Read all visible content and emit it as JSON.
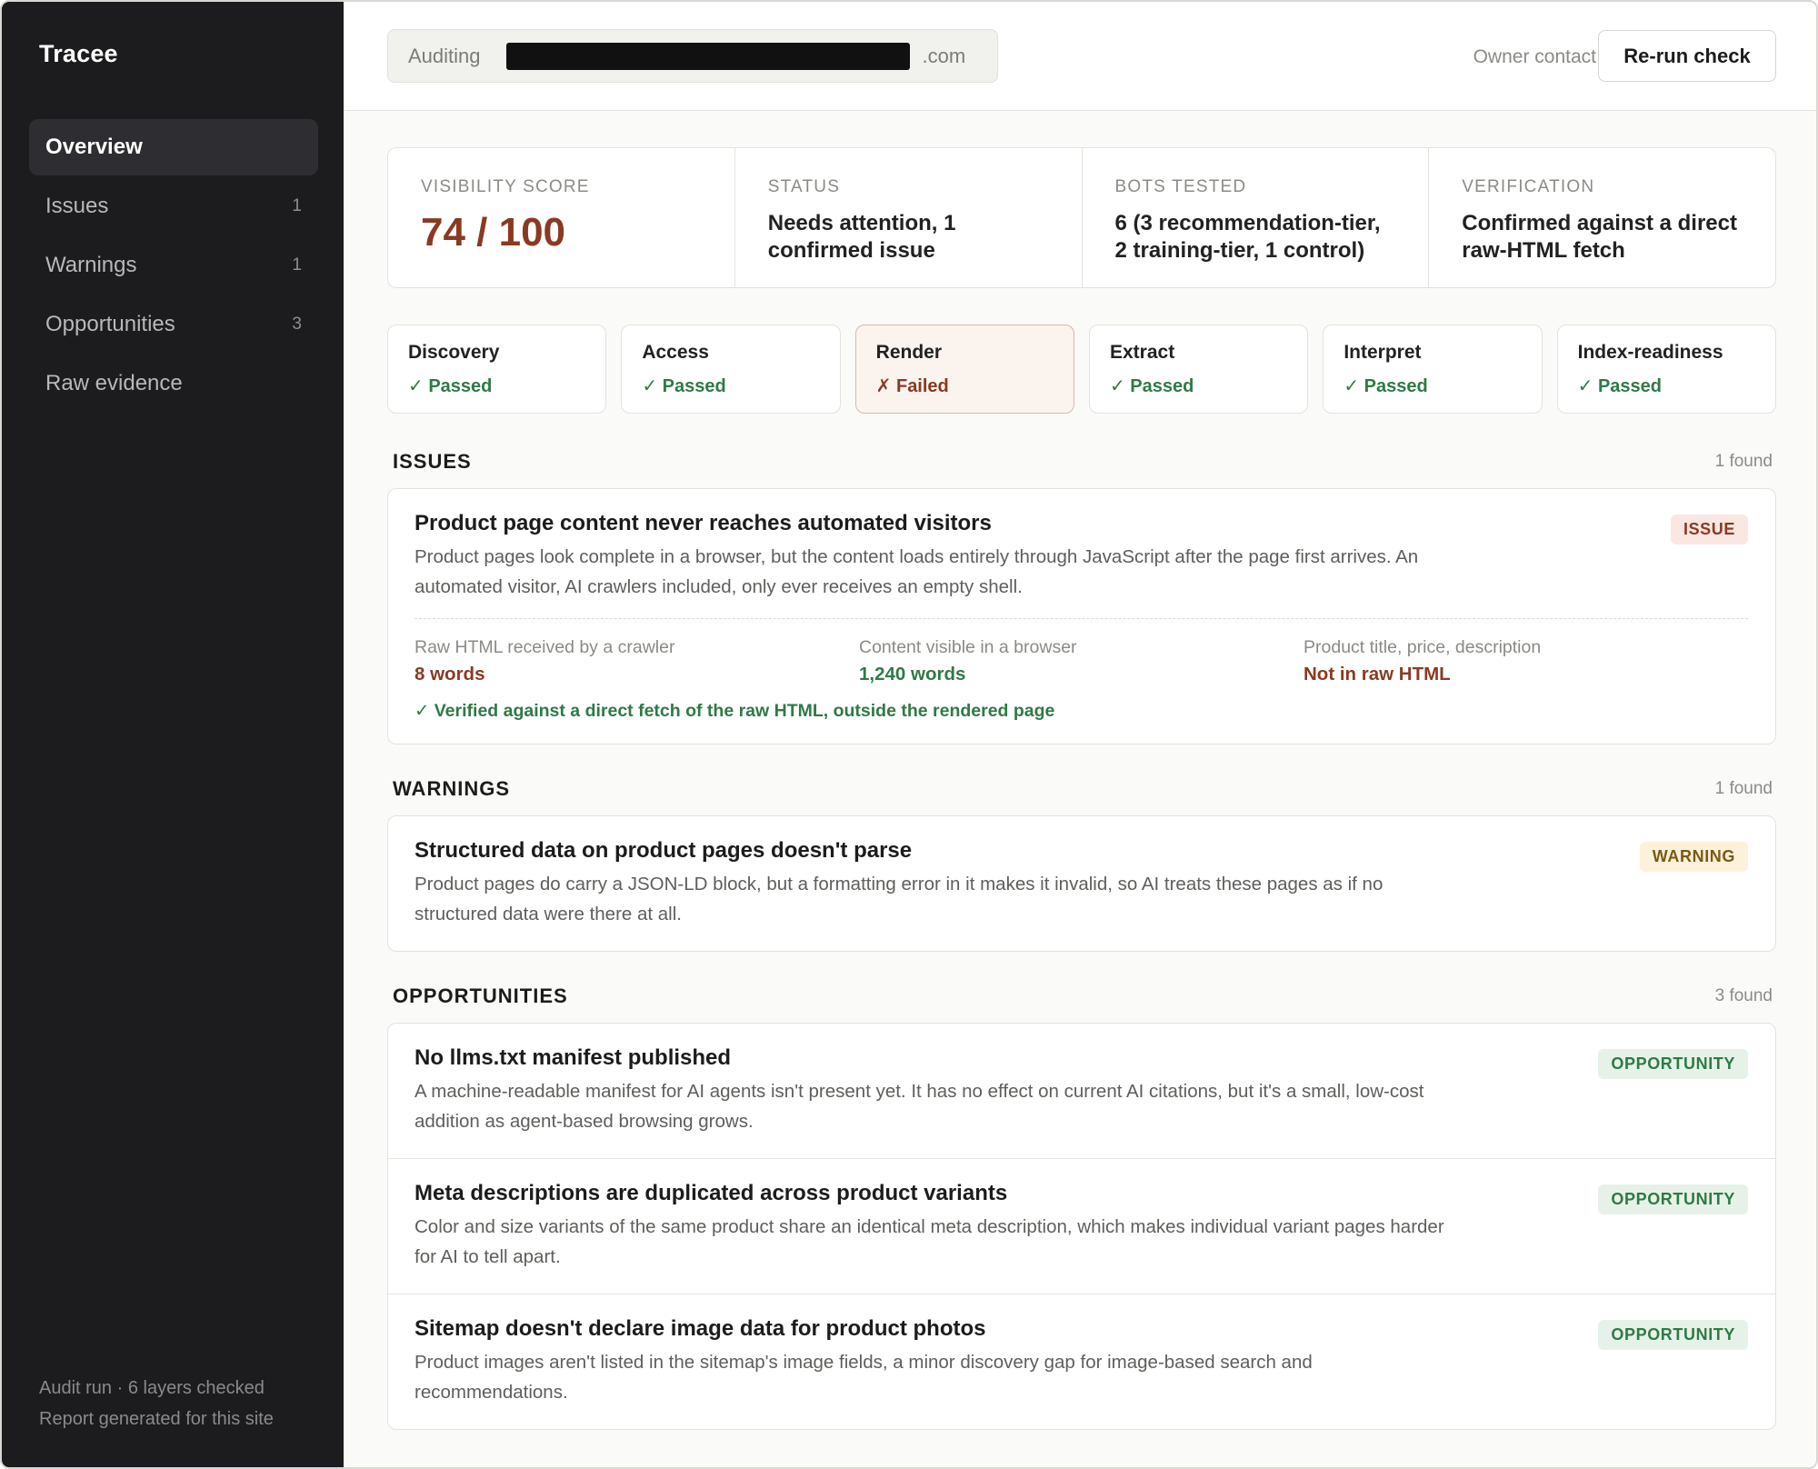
{
  "sidebar": {
    "brand": "Tracee",
    "items": [
      {
        "label": "Overview",
        "count": ""
      },
      {
        "label": "Issues",
        "count": "1"
      },
      {
        "label": "Warnings",
        "count": "1"
      },
      {
        "label": "Opportunities",
        "count": "3"
      },
      {
        "label": "Raw evidence",
        "count": ""
      }
    ],
    "footer_line1": "Audit run · 6 layers checked",
    "footer_line2": "Report generated for this site"
  },
  "topbar": {
    "auditing_label": "Auditing",
    "domain_suffix": ".com",
    "owner_label": "Owner contact",
    "rerun_label": "Re-run check"
  },
  "stats": {
    "score_label": "VISIBILITY SCORE",
    "score_value": "74 / 100",
    "status_label": "STATUS",
    "status_value": "Needs attention, 1 confirmed issue",
    "bots_label": "BOTS TESTED",
    "bots_value": "6 (3 recommendation-tier, 2 training-tier, 1 control)",
    "verification_label": "VERIFICATION",
    "verification_value": "Confirmed against a direct raw-HTML fetch"
  },
  "layers": [
    {
      "name": "Discovery",
      "status": "✓ Passed"
    },
    {
      "name": "Access",
      "status": "✓ Passed"
    },
    {
      "name": "Render",
      "status": "✗ Failed"
    },
    {
      "name": "Extract",
      "status": "✓ Passed"
    },
    {
      "name": "Interpret",
      "status": "✓ Passed"
    },
    {
      "name": "Index-readiness",
      "status": "✓ Passed"
    }
  ],
  "issues": {
    "title": "ISSUES",
    "count": "1 found",
    "items": [
      {
        "title": "Product page content never reaches automated visitors",
        "badge": "ISSUE",
        "desc": "Product pages look complete in a browser, but the content loads entirely through JavaScript after the page first arrives. An automated visitor, AI crawlers included, only ever receives an empty shell.",
        "evidence": [
          {
            "label": "Raw HTML received by a crawler",
            "value": "8 words"
          },
          {
            "label": "Content visible in a browser",
            "value": "1,240 words"
          },
          {
            "label": "Product title, price, description",
            "value": "Not in raw HTML"
          }
        ],
        "verified": "✓ Verified against a direct fetch of the raw HTML, outside the rendered page"
      }
    ]
  },
  "warnings": {
    "title": "WARNINGS",
    "count": "1 found",
    "items": [
      {
        "title": "Structured data on product pages doesn't parse",
        "badge": "WARNING",
        "desc": "Product pages do carry a JSON-LD block, but a formatting error in it makes it invalid, so AI treats these pages as if no structured data were there at all."
      }
    ]
  },
  "opportunities": {
    "title": "OPPORTUNITIES",
    "count": "3 found",
    "items": [
      {
        "title": "No llms.txt manifest published",
        "badge": "OPPORTUNITY",
        "desc": "A machine-readable manifest for AI agents isn't present yet. It has no effect on current AI citations, but it's a small, low-cost addition as agent-based browsing grows."
      },
      {
        "title": "Meta descriptions are duplicated across product variants",
        "badge": "OPPORTUNITY",
        "desc": "Color and size variants of the same product share an identical meta description, which makes individual variant pages harder for AI to tell apart."
      },
      {
        "title": "Sitemap doesn't declare image data for product photos",
        "badge": "OPPORTUNITY",
        "desc": "Product images aren't listed in the sitemap's image fields, a minor discovery gap for image-based search and recommendations."
      }
    ]
  },
  "colors": {
    "sidebar_bg": "#1c1c1e",
    "accent_red": "#8a3a22",
    "accent_green": "#2f7a46",
    "warning_amber": "#7a5a14"
  }
}
